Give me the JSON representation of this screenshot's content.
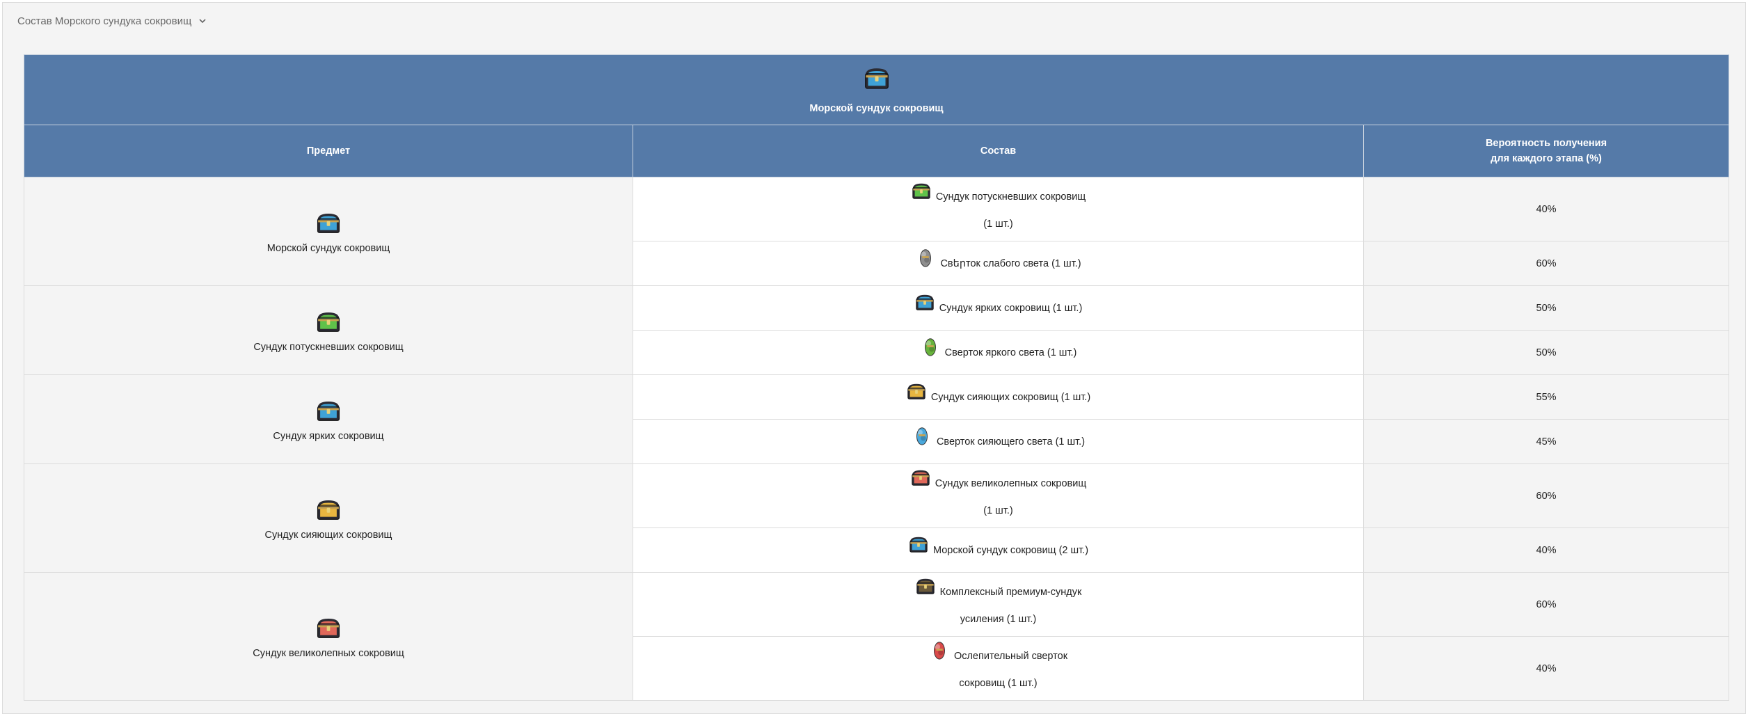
{
  "summary": {
    "label": "Состав Морского сундука сокровищ"
  },
  "table": {
    "title": "Морской сундук сокровищ",
    "headers": {
      "item": "Предмет",
      "composition": "Состав",
      "prob_line1": "Вероятность получения",
      "prob_line2": "для каждого этапа (%)"
    },
    "groups": [
      {
        "name": "Морской сундук сокровищ",
        "icon": "blue-chest-icon",
        "rows": [
          {
            "line1": "Сундук потускневших сокровищ",
            "line2": "(1 шт.)",
            "icon": "green-chest-icon",
            "prob": "40%"
          },
          {
            "line1": "Свերток слабого света (1 шт.)",
            "line2": "",
            "icon": "gray-scroll-icon",
            "prob": "60%"
          }
        ]
      },
      {
        "name": "Сундук потускневших сокровищ",
        "icon": "green-chest-icon",
        "rows": [
          {
            "line1": "Сундук ярких сокровищ (1 шт.)",
            "line2": "",
            "icon": "blue-chest-icon",
            "prob": "50%"
          },
          {
            "line1": "Сверток яркого света (1 шт.)",
            "line2": "",
            "icon": "green-scroll-icon",
            "prob": "50%"
          }
        ]
      },
      {
        "name": "Сундук ярких сокровищ",
        "icon": "blue-chest-icon",
        "rows": [
          {
            "line1": "Сундук сияющих сокровищ (1 шт.)",
            "line2": "",
            "icon": "gold-chest-icon",
            "prob": "55%"
          },
          {
            "line1": "Сверток сияющего света (1 шт.)",
            "line2": "",
            "icon": "blue-scroll-icon",
            "prob": "45%"
          }
        ]
      },
      {
        "name": "Сундук сияющих сокровищ",
        "icon": "gold-chest-icon",
        "rows": [
          {
            "line1": "Сундук великолепных сокровищ",
            "line2": "(1 шт.)",
            "icon": "red-chest-icon",
            "prob": "60%"
          },
          {
            "line1": "Морской сундук сокровищ (2 шт.)",
            "line2": "",
            "icon": "blue-chest-icon",
            "prob": "40%"
          }
        ]
      },
      {
        "name": "Сундук великолепных сокровищ",
        "icon": "red-chest-icon",
        "rows": [
          {
            "line1": "Комплексный премиум-сундук",
            "line2": "усиления (1 шт.)",
            "icon": "dark-chest-icon",
            "prob": "60%"
          },
          {
            "line1": "Ослепительный сверток",
            "line2": "сокровищ (1 шт.)",
            "icon": "red-scroll-icon",
            "prob": "40%"
          }
        ]
      }
    ]
  },
  "colors": {
    "header_bg": "#557aa8",
    "chest_blue": "#3fa2d6",
    "chest_green": "#5fc24a",
    "chest_gold": "#e8b640",
    "chest_red": "#e0685a",
    "chest_dark": "#6b5a3a",
    "scroll_gray": "#8e8e8e",
    "scroll_green": "#67b33c",
    "scroll_blue": "#4aa8dc",
    "scroll_red": "#d94a4a"
  }
}
